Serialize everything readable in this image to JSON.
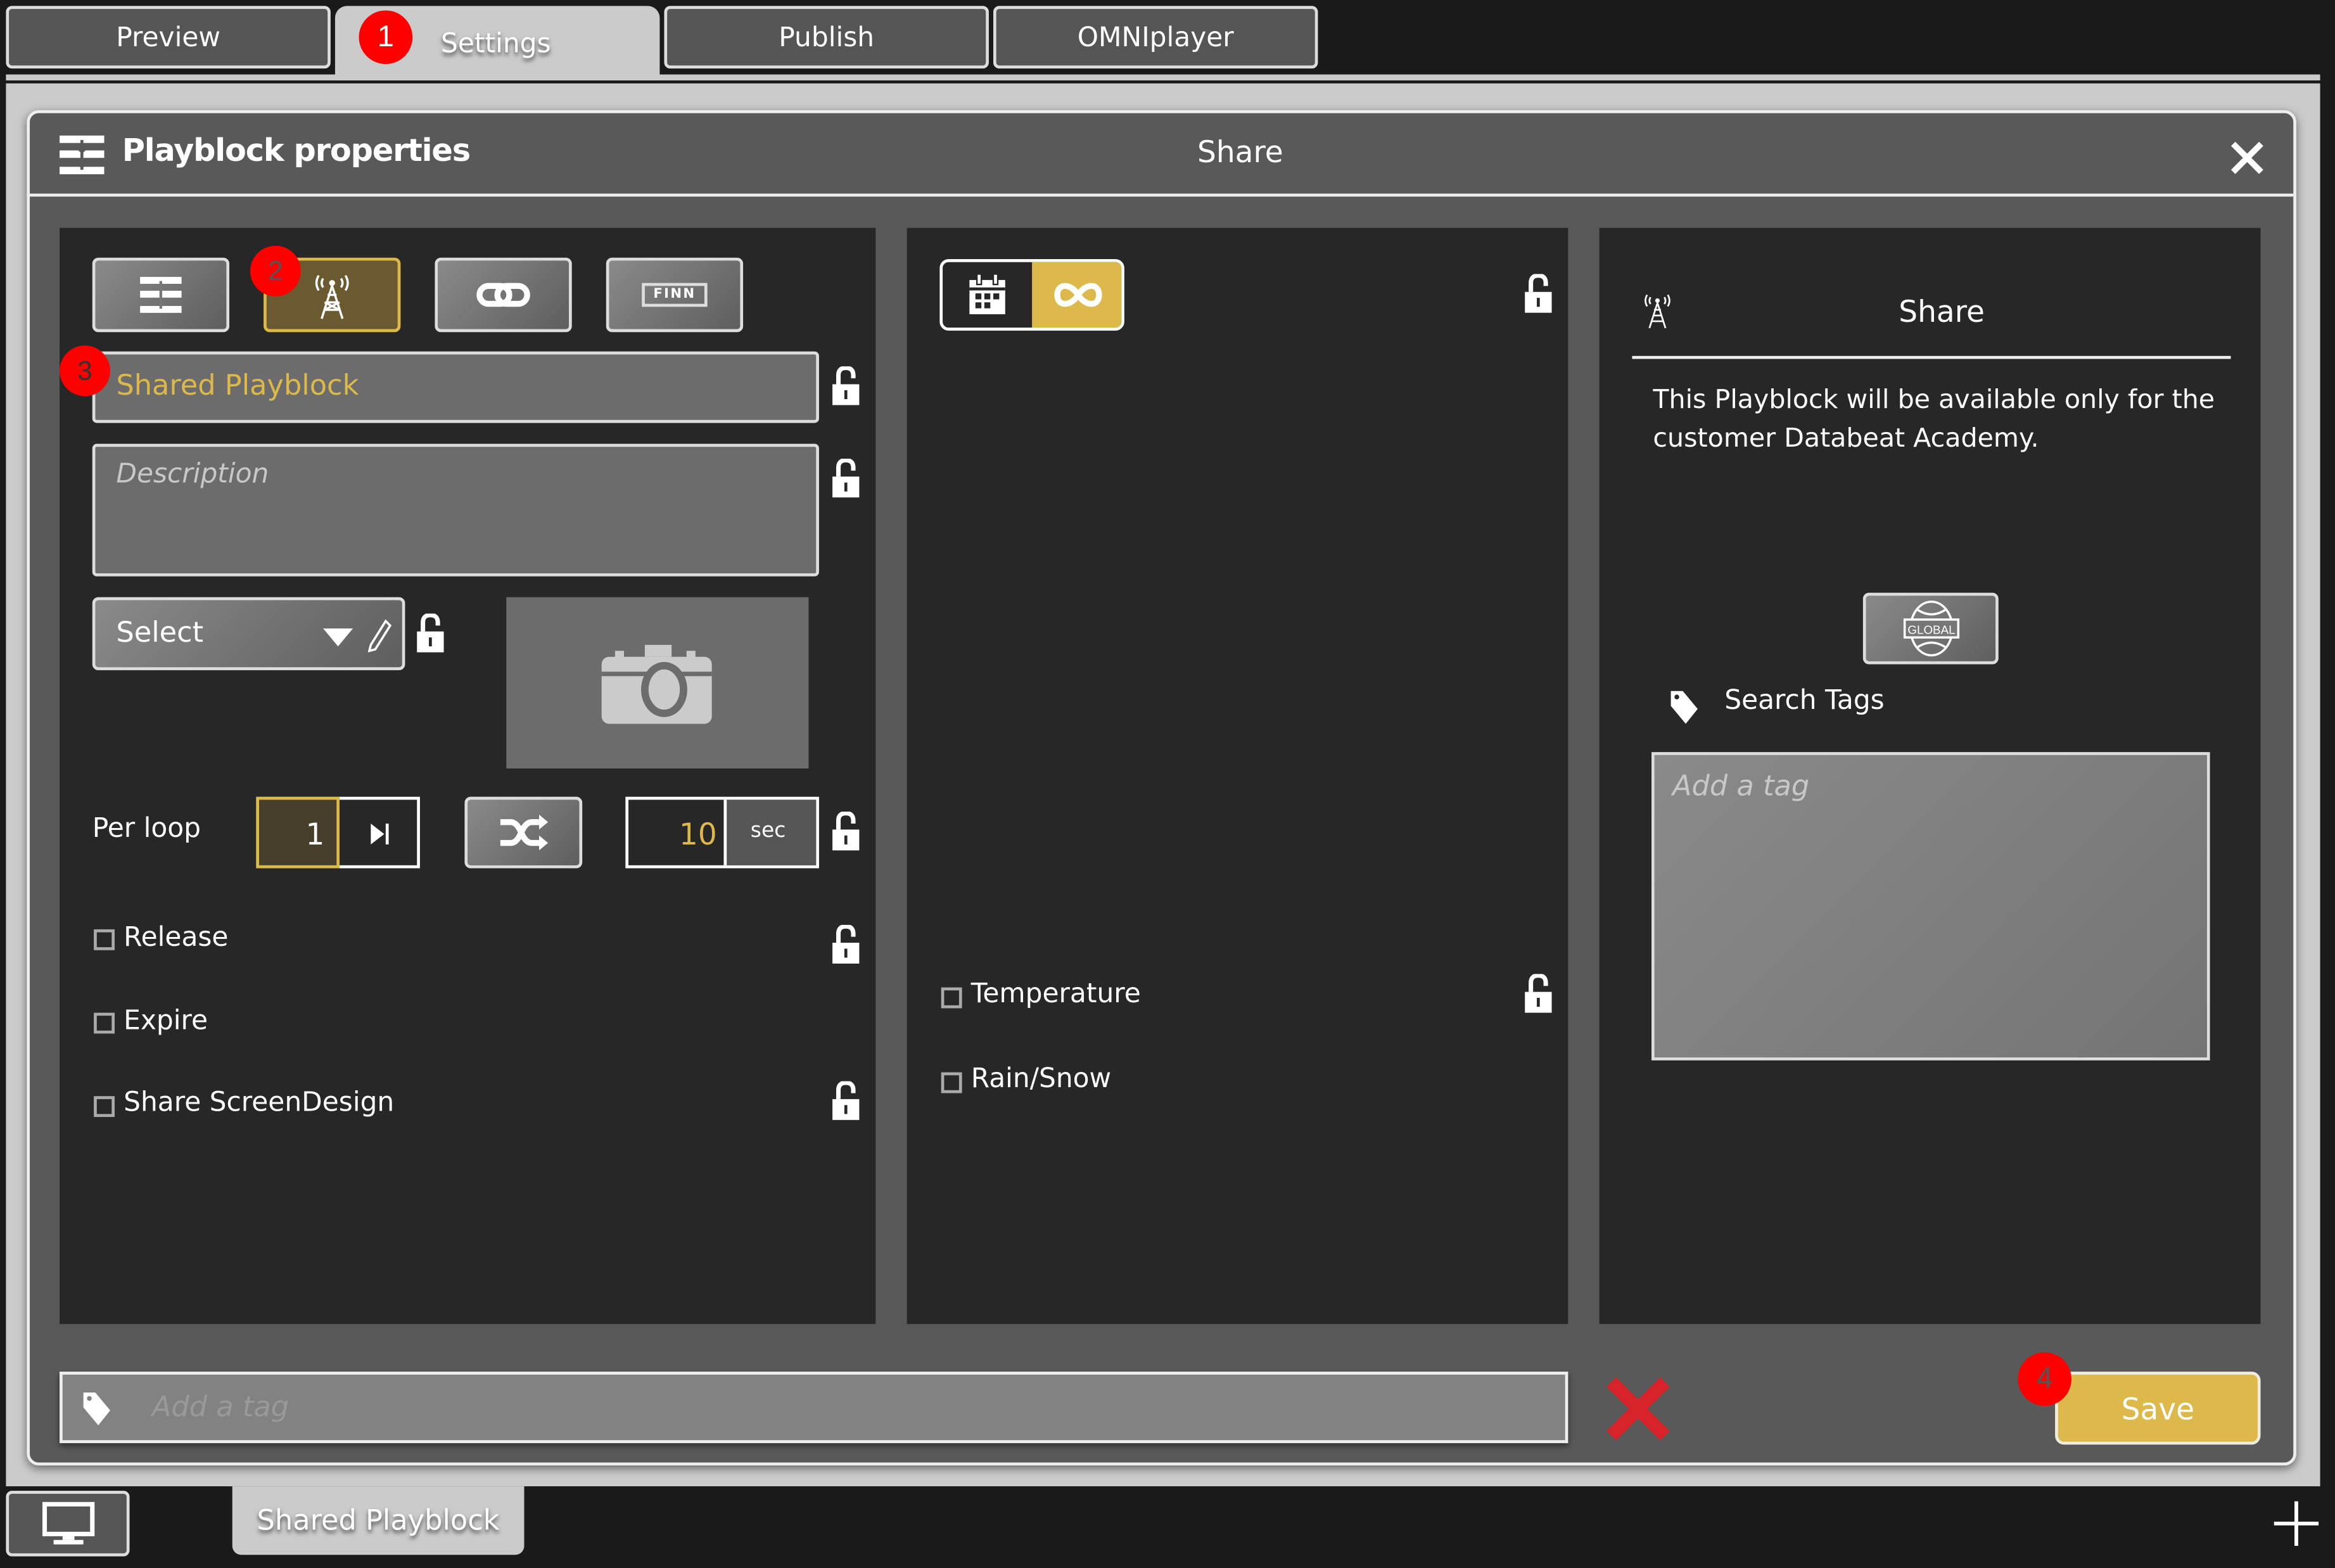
{
  "top_tabs": [
    {
      "label": "Preview",
      "active": false
    },
    {
      "label": "Settings",
      "active": true
    },
    {
      "label": "Publish",
      "active": false
    },
    {
      "label": "OMNIplayer",
      "active": false
    }
  ],
  "annotations": {
    "step1": "1",
    "step2": "2",
    "step3": "3",
    "step4": "4"
  },
  "dialog": {
    "title": "Playblock properties",
    "section": "Share",
    "close_icon": "close-icon"
  },
  "left_panel": {
    "mode_buttons": [
      {
        "icon": "playblock-properties-icon",
        "active": false
      },
      {
        "icon": "broadcast-tower-icon",
        "active": true
      },
      {
        "icon": "link-icon",
        "active": false
      },
      {
        "icon": "finn-icon",
        "label": "FINN",
        "active": false
      }
    ],
    "name_value": "Shared Playblock",
    "description_placeholder": "Description",
    "select_value": "Select",
    "per_loop_label": "Per loop",
    "per_loop_value": "1",
    "duration_value": "10",
    "duration_unit": "sec",
    "checkboxes": [
      {
        "label": "Release",
        "checked": false,
        "lockable": true
      },
      {
        "label": "Expire",
        "checked": false,
        "lockable": false
      },
      {
        "label": "Share ScreenDesign",
        "checked": false,
        "lockable": true
      }
    ]
  },
  "middle_panel": {
    "schedule_toggle": [
      {
        "icon": "calendar-icon",
        "active": false
      },
      {
        "icon": "infinity-icon",
        "active": true
      }
    ],
    "checkboxes": [
      {
        "label": "Temperature",
        "checked": false,
        "lockable": true
      },
      {
        "label": "Rain/Snow",
        "checked": false,
        "lockable": false
      }
    ]
  },
  "right_panel": {
    "title": "Share",
    "description": "This Playblock will be available only for the customer Databeat Academy.",
    "global_label": "GLOBAL",
    "search_tags_label": "Search Tags",
    "tag_placeholder": "Add a tag"
  },
  "footer": {
    "tag_placeholder": "Add a tag",
    "save_label": "Save"
  },
  "bottom_bar": {
    "tab_label": "Shared Playblock"
  },
  "colors": {
    "accent": "#ddb84a",
    "accent_dark": "#6b5a2f",
    "annotation": "#ff0000",
    "cancel": "#d9232a",
    "panel": "#272727",
    "dialog": "#595959"
  }
}
